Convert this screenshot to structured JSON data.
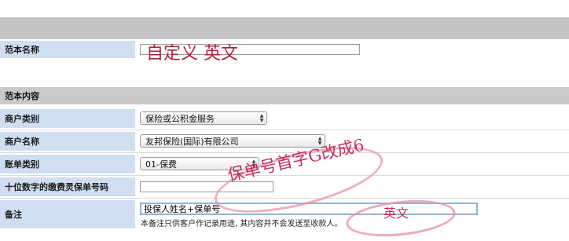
{
  "template_name": {
    "label": "范本名称",
    "value": "",
    "annotation": "自定义 英文"
  },
  "template_content": {
    "heading": "范本内容",
    "merchant_category": {
      "label": "商户类别",
      "selected": "保险或公积金服务"
    },
    "merchant_name": {
      "label": "商户名称",
      "selected": "友邦保险(国际)有限公司"
    },
    "bill_category": {
      "label": "账单类别",
      "selected": "01-保费"
    },
    "policy_number": {
      "label": "十位数字的缴费灵保单号码",
      "value": ""
    },
    "remarks": {
      "label": "备注",
      "value": "投保人姓名+保单号",
      "hint": "本备注只供客户作记录用途, 其内容并不会发送至收款人。"
    }
  },
  "annotations": {
    "policy_note": "保单号首字G改成6",
    "remarks_note": "英文"
  },
  "colors": {
    "label_bg": "#cfdff1",
    "section_bg": "#c9c9c9",
    "annotation": "#b2223f"
  }
}
